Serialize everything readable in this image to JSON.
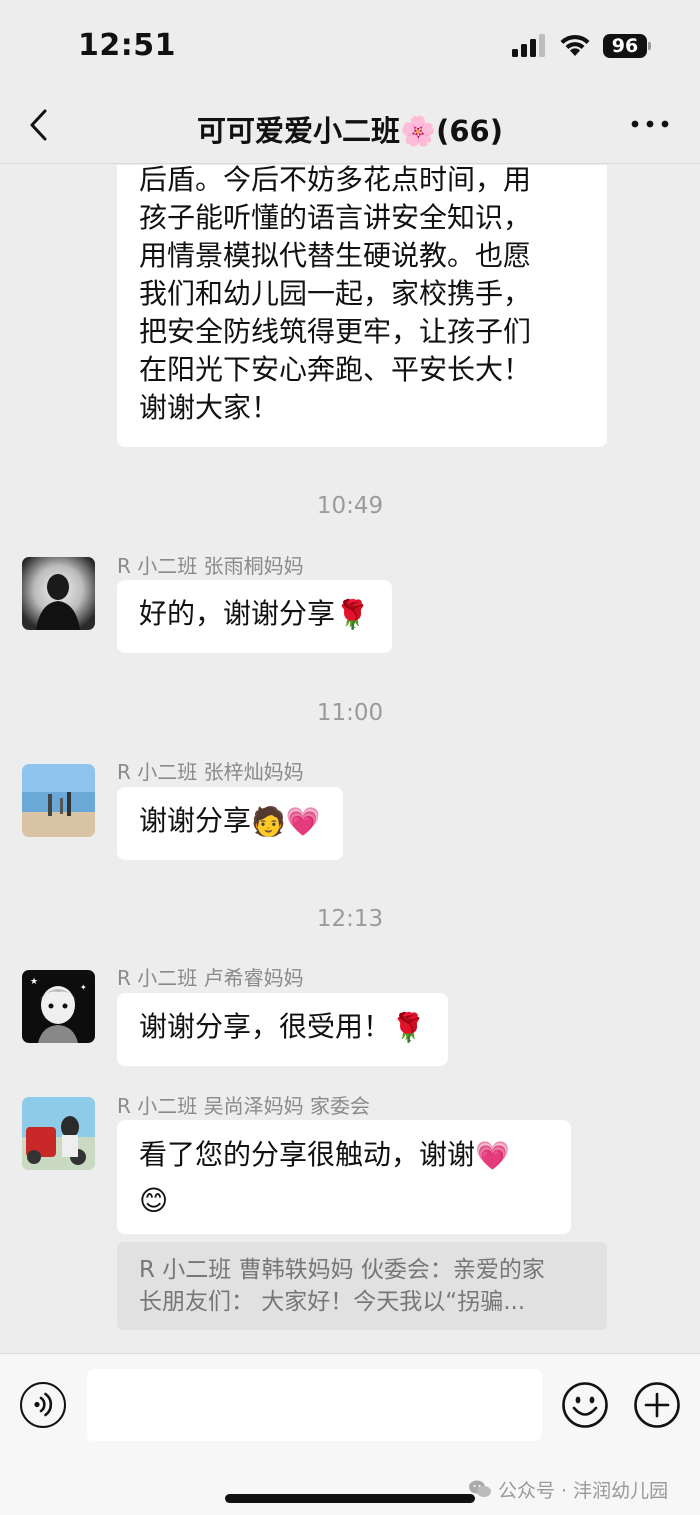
{
  "status_bar": {
    "time": "12:51",
    "battery": "96"
  },
  "header": {
    "title": "可可爱爱小二班🌸(66)"
  },
  "messages": [
    {
      "lines": [
        "后盾。今后不妨多花点时间，用",
        "孩子能听懂的语言讲安全知识，",
        "用情景模拟代替生硬说教。也愿",
        "我们和幼儿园一起，家校携手，",
        "把安全防线筑得更牢，让孩子们",
        "在阳光下安心奔跑、平安长大！",
        "谢谢大家！"
      ]
    },
    {
      "timestamp": "10:49",
      "sender": "R 小二班 张雨桐妈妈",
      "text": "好的，谢谢分享",
      "emoji": "🌹"
    },
    {
      "timestamp": "11:00",
      "sender": "R 小二班 张梓灿妈妈",
      "text": "谢谢分享",
      "emoji": "🧑💗"
    },
    {
      "timestamp": "12:13",
      "sender": "R 小二班 卢希睿妈妈",
      "text": "谢谢分享，很受用！",
      "emoji": "🌹"
    },
    {
      "sender": "R 小二班 吴尚泽妈妈 家委会",
      "text": "看了您的分享很触动，谢谢",
      "emoji": "💗",
      "line2_emoji": "😊"
    }
  ],
  "quote": {
    "line1": "R 小二班 曹韩轶妈妈 伙委会：亲爱的家",
    "line2": "长朋友们：  大家好！今天我以“拐骗..."
  },
  "input": {
    "placeholder": ""
  },
  "watermark": "公众号 · 沣润幼儿园",
  "icons": {
    "back": "back-arrow-icon",
    "more": "more-dots-icon",
    "voice": "voice-icon",
    "emoji": "smiley-icon",
    "add": "plus-circle-icon"
  }
}
